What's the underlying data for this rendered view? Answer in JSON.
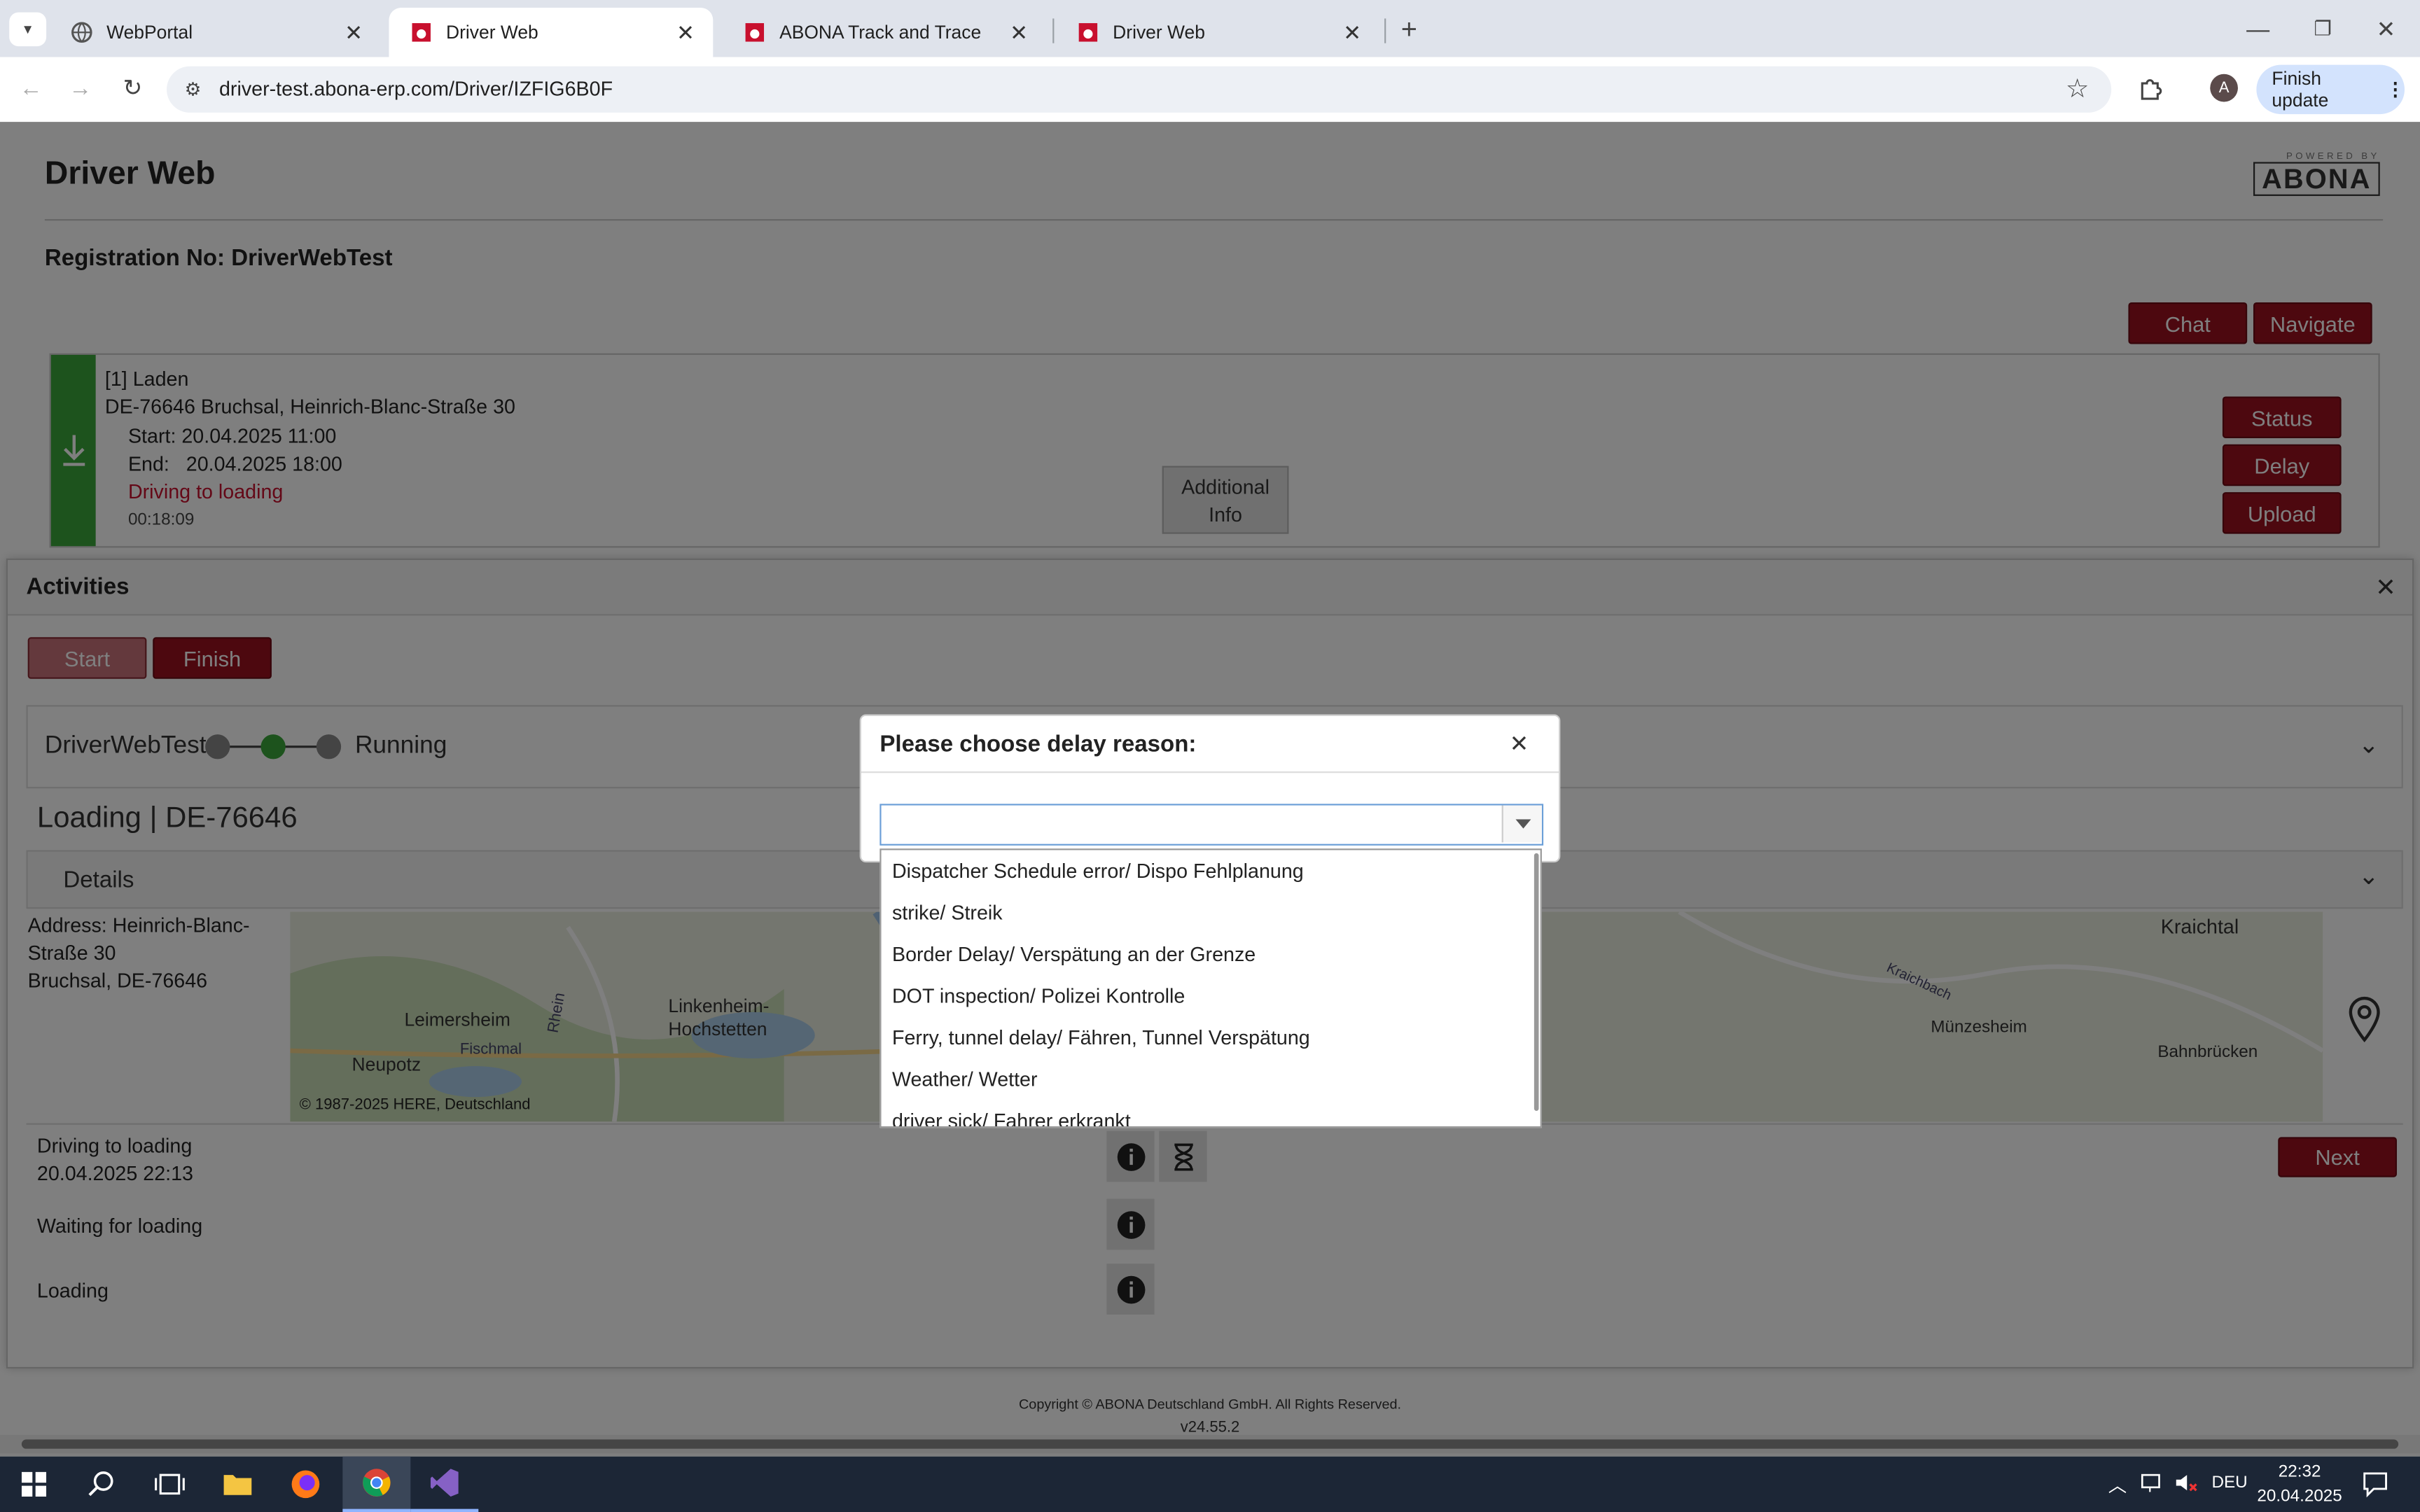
{
  "browser": {
    "tabs": [
      {
        "label": "WebPortal",
        "active": false
      },
      {
        "label": "Driver Web",
        "active": true
      },
      {
        "label": "ABONA Track and Trace",
        "active": false
      },
      {
        "label": "Driver Web",
        "active": false
      }
    ],
    "url": "driver-test.abona-erp.com/Driver/IZFIG6B0F",
    "profile_initial": "A",
    "finish_update_label": "Finish update"
  },
  "page": {
    "title": "Driver Web",
    "logo_text": "ABONA",
    "logo_top_text": "POWERED BY",
    "registration": "Registration No: DriverWebTest",
    "chat_label": "Chat",
    "navigate_label": "Navigate",
    "order": {
      "heading": "[1] Laden",
      "address": "DE-76646 Bruchsal, Heinrich-Blanc-Straße 30",
      "start": "Start: 20.04.2025 11:00",
      "end": "End:   20.04.2025 18:00",
      "status": "Driving to loading",
      "timer": "00:18:09",
      "additional_info": "Additional Info",
      "status_btn": "Status",
      "delay_btn": "Delay",
      "upload_btn": "Upload"
    },
    "activities": {
      "title": "Activities",
      "start_label": "Start",
      "finish_label": "Finish",
      "driver": "DriverWebTest",
      "running": "Running",
      "loading_title": "Loading | DE-76646",
      "details_label": "Details",
      "address_line1": "Address: Heinrich-Blanc-",
      "address_line2": "Straße 30",
      "address_line3": "Bruchsal, DE-76646",
      "map_labels": {
        "leimersheim": "Leimersheim",
        "linkenheim": "Linkenheim-",
        "hochstetten": "Hochstetten",
        "neupotz": "Neupotz",
        "fischmal": "Fischmal",
        "rhein": "Rhein",
        "kraichtal": "Kraichtal",
        "munzesheim": "Münzesheim",
        "bahnbrucken": "Bahnbrücken",
        "kraichbach": "Kraichbach",
        "copyright": "© 1987-2025 HERE, Deutschland"
      },
      "steps": [
        {
          "label": "Driving to loading",
          "time": "20.04.2025 22:13"
        },
        {
          "label": "Waiting for loading",
          "time": ""
        },
        {
          "label": "Loading",
          "time": ""
        }
      ],
      "next_label": "Next"
    },
    "footer": {
      "copyright": "Copyright © ABONA Deutschland GmbH. All Rights Reserved.",
      "version": "v24.55.2"
    }
  },
  "modal": {
    "title": "Please choose delay reason:",
    "select_value": "",
    "options": [
      "Dispatcher Schedule error/ Dispo Fehlplanung",
      "strike/ Streik",
      "Border Delay/ Verspätung an der Grenze",
      "DOT inspection/ Polizei Kontrolle",
      "Ferry, tunnel delay/ Fähren, Tunnel Verspätung",
      "Weather/ Wetter",
      "driver sick/ Fahrer erkrankt"
    ]
  },
  "taskbar": {
    "language": "DEU",
    "time": "22:32",
    "date": "20.04.2025"
  },
  "colors": {
    "accent_red": "#9b111e",
    "green": "#3aa63a",
    "tabbar": "#dfe3eb",
    "taskbar": "#1c2636"
  }
}
